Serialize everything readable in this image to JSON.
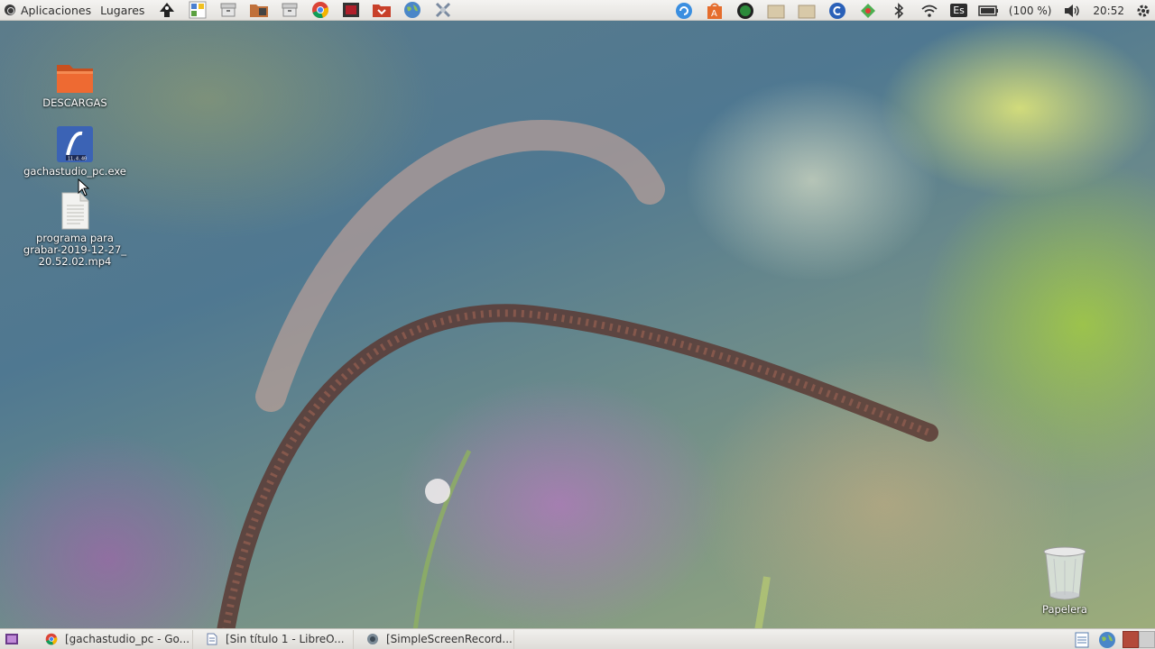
{
  "top_panel": {
    "apps_menu": "Aplicaciones",
    "places_menu": "Lugares",
    "launchers": [
      "inkscape-icon",
      "settings-icon",
      "archive-icon",
      "folder-music-icon",
      "archive2-icon",
      "chrome-icon",
      "red-app-icon",
      "folder-red-icon",
      "globe-icon",
      "tools-icon"
    ],
    "tray": {
      "keyboard_layout": "Es",
      "battery_percent": "(100 %)",
      "clock": "20:52"
    }
  },
  "desktop": {
    "icons": [
      {
        "label": "DESCARGAS",
        "icon": "folder-icon"
      },
      {
        "label": "gachastudio_pc.exe",
        "icon": "exe-icon"
      },
      {
        "label": "programa para grabar-2019-12-27_ 20.52.02.mp4",
        "icon": "video-file-icon"
      }
    ],
    "trash_label": "Papelera"
  },
  "taskbar": {
    "tasks": [
      {
        "label": "[gachastudio_pc - Go...",
        "icon": "chrome-icon"
      },
      {
        "label": "[Sin título 1 - LibreO...",
        "icon": "document-icon"
      },
      {
        "label": "[SimpleScreenRecord...",
        "icon": "recorder-icon"
      }
    ]
  },
  "colors": {
    "panel": "#e9e7e3",
    "folder_orange": "#e8622c",
    "chrome_red": "#db4437",
    "chrome_green": "#0f9d58",
    "chrome_yellow": "#f4b400",
    "chrome_blue": "#4285f4"
  }
}
